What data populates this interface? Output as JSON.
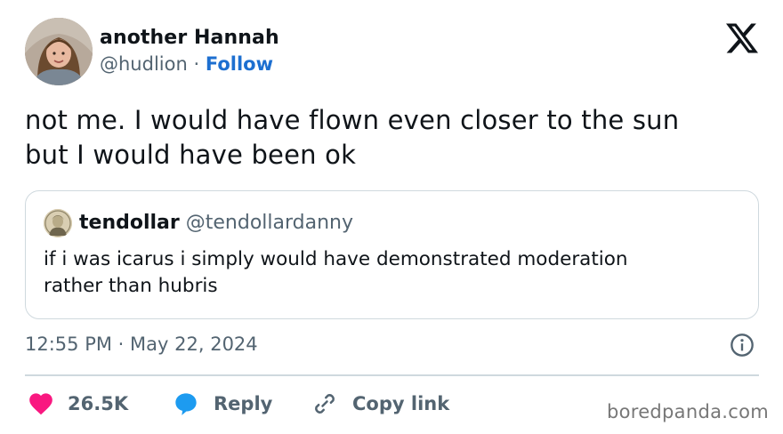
{
  "author": {
    "display_name": "another Hannah",
    "handle": "@hudlion",
    "separator": "·",
    "follow_label": "Follow",
    "avatar_icon": "profile-photo"
  },
  "tweet": {
    "text_line1": "not me. I would have flown even closer to the sun",
    "text_line2": "but I would have been ok"
  },
  "quote": {
    "display_name": "tendollar",
    "handle": "@tendollardanny",
    "text_line1": "if i was icarus i simply would have demonstrated moderation",
    "text_line2": "rather than hubris",
    "avatar_icon": "hamilton-portrait"
  },
  "meta": {
    "time": "12:55 PM",
    "separator": "·",
    "date": "May 22, 2024"
  },
  "actions": {
    "like_count": "26.5K",
    "reply_label": "Reply",
    "copy_label": "Copy link"
  },
  "watermark": "boredpanda.com",
  "colors": {
    "text": "#0f1419",
    "secondary": "#536471",
    "link": "#1d6fd0",
    "like": "#f91880",
    "reply": "#1d9bf0",
    "border": "#cfd9de"
  }
}
